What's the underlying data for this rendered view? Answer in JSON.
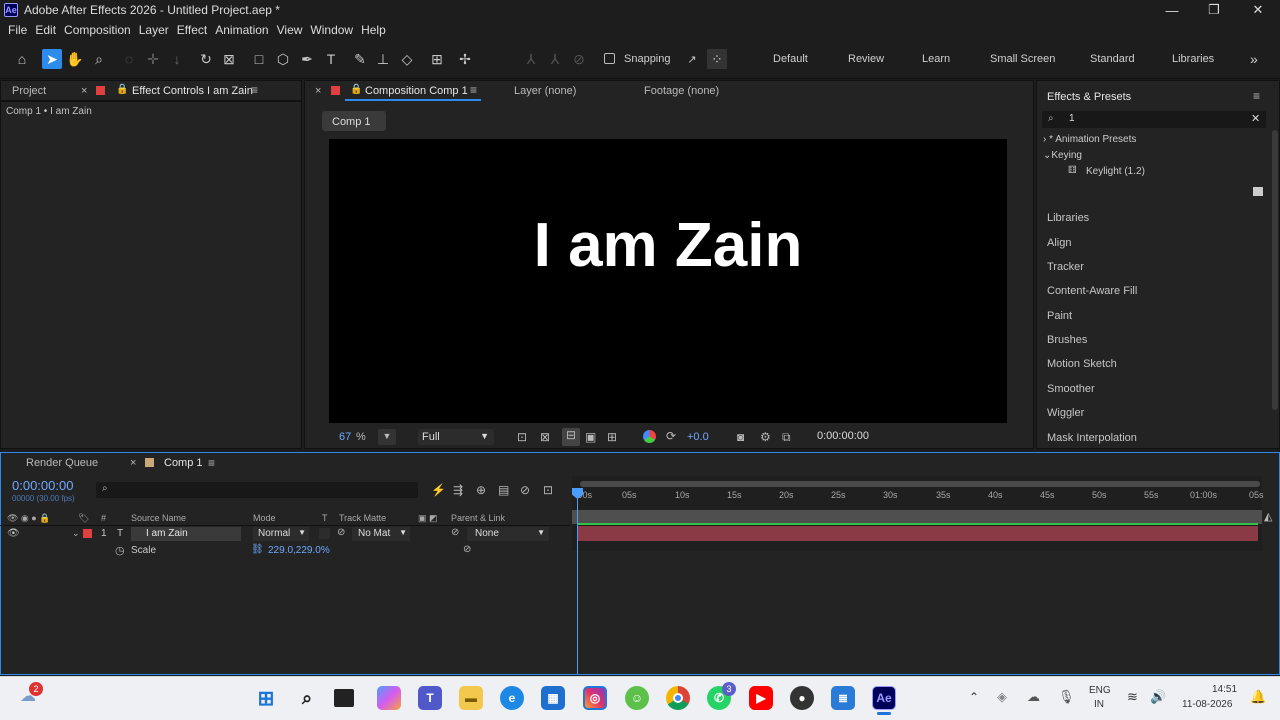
{
  "window": {
    "title": "Adobe After Effects 2026 - Untitled Project.aep *",
    "app_badge": "Ae",
    "min": "—",
    "max": "❐",
    "close": "✕"
  },
  "menu": [
    "File",
    "Edit",
    "Composition",
    "Layer",
    "Effect",
    "Animation",
    "View",
    "Window",
    "Help"
  ],
  "toolbar": {
    "snapping": "Snapping",
    "workspaces": [
      "Default",
      "Review",
      "Learn",
      "Small Screen",
      "Standard",
      "Libraries"
    ],
    "more": "»"
  },
  "left_panel": {
    "tab_project": "Project",
    "tab_effect_controls": "Effect Controls I am Zain",
    "breadcrumb": "Comp 1 • I am Zain"
  },
  "comp_panel": {
    "tab_composition": "Composition Comp 1",
    "tab_layer": "Layer (none)",
    "tab_footage": "Footage (none)",
    "chip": "Comp 1",
    "canvas_text": "I am Zain",
    "zoom": "67",
    "zoom_unit": "%",
    "resolution": "Full",
    "exposure": "+0.0",
    "timecode": "0:00:00:00"
  },
  "effects": {
    "title": "Effects & Presets",
    "search": "1",
    "tree": [
      "* Animation Presets",
      "Keying",
      "Keylight (1.2)"
    ],
    "panels": [
      "Libraries",
      "Align",
      "Tracker",
      "Content-Aware Fill",
      "Paint",
      "Brushes",
      "Motion Sketch",
      "Smoother",
      "Wiggler",
      "Mask Interpolation"
    ]
  },
  "timeline": {
    "tab_render": "Render Queue",
    "tab_comp": "Comp 1",
    "timecode": "0:00:00:00",
    "fps": "00000 (30.00 fps)",
    "headers": {
      "num": "#",
      "source": "Source Name",
      "mode": "Mode",
      "t": "T",
      "trackmatte": "Track Matte",
      "parent": "Parent & Link"
    },
    "layer": {
      "num": "1",
      "type": "T",
      "name": "I am Zain",
      "mode": "Normal",
      "matte": "No Mat",
      "parent": "None"
    },
    "property": {
      "name": "Scale",
      "value": "229.0,229.0%"
    },
    "ruler": [
      ":00s",
      "05s",
      "10s",
      "15s",
      "20s",
      "25s",
      "30s",
      "35s",
      "40s",
      "45s",
      "50s",
      "55s",
      "01:00s",
      "05s"
    ]
  },
  "taskbar": {
    "notif_count": "2",
    "whatsapp_badge": "3",
    "lang_top": "ENG",
    "lang_bottom": "IN",
    "time": "14:51",
    "date": "11-08-2026"
  }
}
